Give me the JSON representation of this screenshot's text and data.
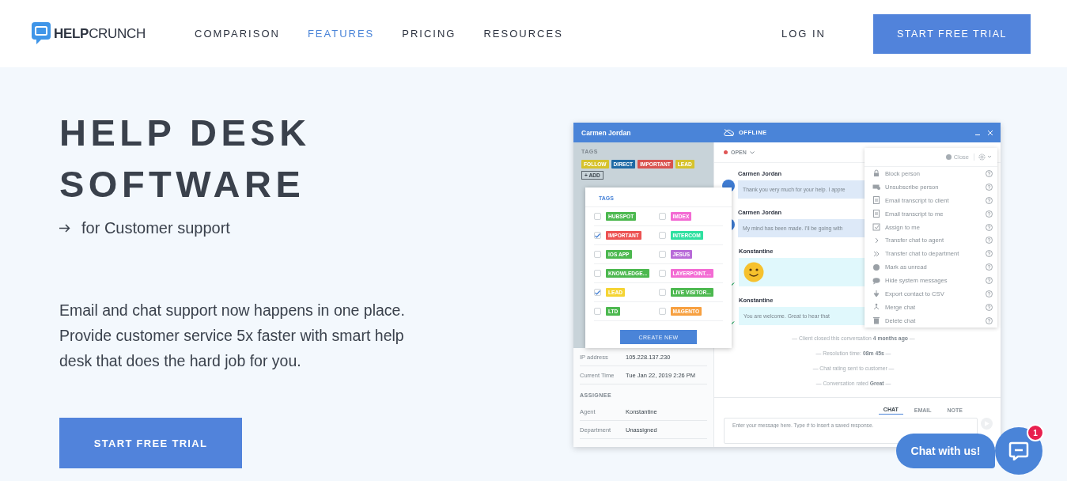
{
  "header": {
    "logo": {
      "bold": "HELP",
      "light": "CRUNCH"
    },
    "nav": [
      {
        "label": "COMPARISON",
        "selected": false
      },
      {
        "label": "FEATURES",
        "selected": true
      },
      {
        "label": "PRICING",
        "selected": false
      },
      {
        "label": "RESOURCES",
        "selected": false
      }
    ],
    "login": "LOG IN",
    "cta": "START FREE TRIAL"
  },
  "hero": {
    "title_lines": [
      "HELP DESK",
      "SOFTWARE"
    ],
    "subtitle": "for Customer support",
    "description": "Email and chat support now happens in one place. Provide customer service 5x faster with smart help desk that does the hard job for you.",
    "cta": "START FREE TRIAL"
  },
  "app": {
    "contact_name": "Carmen Jordan",
    "status": "OFFLINE",
    "sidebar": {
      "tags_heading": "TAGS",
      "tags": [
        {
          "label": "FOLLOW",
          "color": "#d6c22c"
        },
        {
          "label": "DIRECT",
          "color": "#1f6aa5"
        },
        {
          "label": "IMPORTANT",
          "color": "#d9534f"
        },
        {
          "label": "LEAD",
          "color": "#d6c22c"
        }
      ],
      "add_label": "+ ADD",
      "tag_picker": {
        "title": "TAGS",
        "options": [
          {
            "label": "HUBSPOT",
            "color": "#4cb84f",
            "checked": false
          },
          {
            "label": "IMDEX",
            "color": "#f36bd3",
            "checked": false
          },
          {
            "label": "IMPORTANT",
            "color": "#ec5252",
            "checked": true
          },
          {
            "label": "INTERCOM",
            "color": "#2fe0a0",
            "checked": false
          },
          {
            "label": "IOS APP",
            "color": "#4cb84f",
            "checked": false
          },
          {
            "label": "JESUS",
            "color": "#b86ad8",
            "checked": false
          },
          {
            "label": "KNOWLEDGE...",
            "color": "#4cb84f",
            "checked": false
          },
          {
            "label": "LAYERPOINT....",
            "color": "#f36bd3",
            "checked": false
          },
          {
            "label": "LEAD",
            "color": "#f5d433",
            "checked": true
          },
          {
            "label": "LIVE VISITOR...",
            "color": "#4cb84f",
            "checked": false
          },
          {
            "label": "LTD",
            "color": "#4cb84f",
            "checked": false
          },
          {
            "label": "MAGENTO",
            "color": "#f7a040",
            "checked": false
          }
        ],
        "create_label": "CREATE NEW"
      },
      "details": [
        {
          "label": "IP address",
          "value": "105.228.137.230"
        },
        {
          "label": "Current Time",
          "value": "Tue Jan 22, 2019 2:26 PM"
        }
      ],
      "assignee_heading": "ASSIGNEE",
      "assignee": [
        {
          "label": "Agent",
          "value": "Konstantine"
        },
        {
          "label": "Department",
          "value": "Unassigned"
        }
      ]
    },
    "chat": {
      "state": "OPEN",
      "close_label": "Close",
      "messages": [
        {
          "kind": "client",
          "author": "Carmen Jordan",
          "text": "Thank you very much for your help. I appre"
        },
        {
          "kind": "client",
          "author": "Carmen Jordan",
          "text": "My mind has been made. I'll be going with"
        },
        {
          "kind": "emoji",
          "author": "Konstantine"
        },
        {
          "kind": "agent",
          "author": "Konstantine",
          "text": "You are welcome. Great to hear that"
        }
      ],
      "events": [
        "— Client closed this conversation **4 months ago** —",
        "— Resolution time: **08m 45s** —",
        "— Chat rating sent to customer —",
        "— Conversation rated **Great** —"
      ],
      "tabs": [
        {
          "label": "CHAT",
          "selected": true
        },
        {
          "label": "EMAIL",
          "selected": false
        },
        {
          "label": "NOTE",
          "selected": false
        }
      ],
      "placeholder": "Enter your message here. Type # to insert a saved response."
    },
    "actions_menu": [
      "Block person",
      "Unsubscribe person",
      "Email transcript to client",
      "Email transcript to me",
      "Assign to me",
      "Transfer chat to agent",
      "Transfer chat to department",
      "Mark as unread",
      "Hide system messages",
      "Export contact to CSV",
      "Merge chat",
      "Delete chat"
    ]
  },
  "widget": {
    "label": "Chat with us!",
    "badge": "1"
  }
}
